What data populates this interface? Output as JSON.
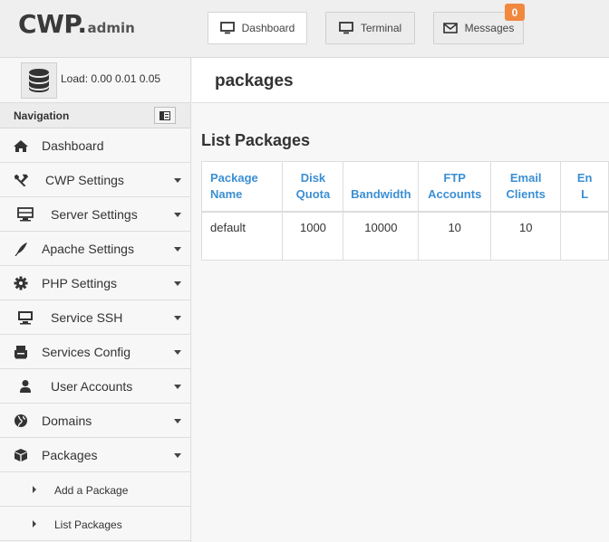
{
  "header": {
    "logo_main": "CWP",
    "logo_dot": ".",
    "logo_sub": "admin",
    "buttons": [
      {
        "label": "Dashboard",
        "icon": "monitor-icon",
        "active": true
      },
      {
        "label": "Terminal",
        "icon": "monitor-icon",
        "active": false
      },
      {
        "label": "Messages",
        "icon": "envelope-icon",
        "active": false,
        "badge": "0"
      }
    ],
    "badge_color": "#f0883e"
  },
  "load": {
    "icon": "database-icon",
    "text": "Load: 0.00  0.01  0.05"
  },
  "sidebar": {
    "heading": "Navigation",
    "toggle_icon": "sidebar-toggle-icon",
    "items": [
      {
        "label": "Dashboard",
        "icon": "home-icon",
        "has_caret": false
      },
      {
        "label": "CWP Settings",
        "icon": "tools-icon",
        "has_caret": true
      },
      {
        "label": "Server Settings",
        "icon": "server-icon",
        "has_caret": true
      },
      {
        "label": "Apache Settings",
        "icon": "feather-icon",
        "has_caret": true
      },
      {
        "label": "PHP Settings",
        "icon": "gear-icon",
        "has_caret": true
      },
      {
        "label": "Service SSH",
        "icon": "monitor-icon",
        "has_caret": true
      },
      {
        "label": "Services Config",
        "icon": "config-icon",
        "has_caret": true
      },
      {
        "label": "User Accounts",
        "icon": "user-icon",
        "has_caret": true
      },
      {
        "label": "Domains",
        "icon": "globe-icon",
        "has_caret": true
      },
      {
        "label": "Packages",
        "icon": "box-icon",
        "has_caret": true
      }
    ],
    "subitems": [
      {
        "label": "Add a Package"
      },
      {
        "label": "List Packages"
      }
    ]
  },
  "page": {
    "title": "packages",
    "section_title": "List Packages"
  },
  "table": {
    "header_color": "#3b8fd3",
    "columns": [
      {
        "line1": "Package",
        "line2": "Name"
      },
      {
        "line1": "Disk",
        "line2": "Quota"
      },
      {
        "line1": "",
        "line2": "Bandwidth"
      },
      {
        "line1": "FTP",
        "line2": "Accounts"
      },
      {
        "line1": "Email",
        "line2": "Clients"
      },
      {
        "line1": "En",
        "line2": "L"
      }
    ],
    "rows": [
      [
        "default",
        "1000",
        "10000",
        "10",
        "10",
        ""
      ]
    ]
  }
}
